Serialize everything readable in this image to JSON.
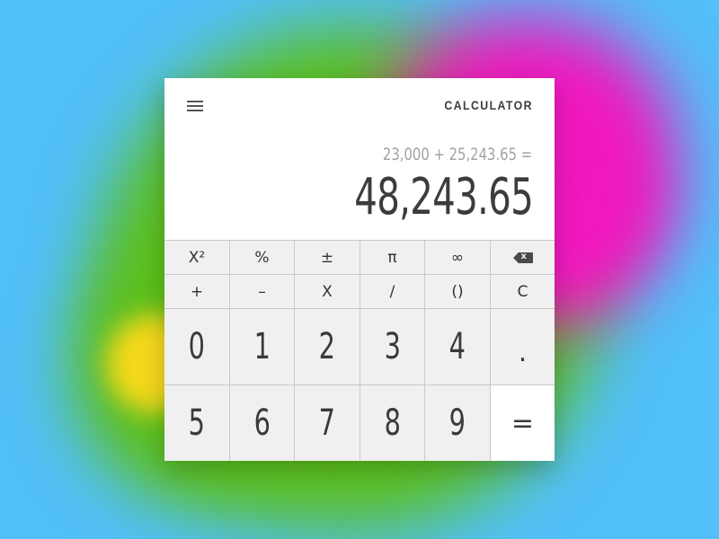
{
  "app": {
    "title": "CALCULATOR"
  },
  "display": {
    "expression": "23,000 + 25,243.65 =",
    "result": "48,243.65"
  },
  "keys": {
    "row1": [
      "X²",
      "%",
      "±",
      "π",
      "∞",
      ""
    ],
    "row2": [
      "+",
      "–",
      "X",
      "/",
      "()",
      "C"
    ],
    "row3": [
      "0",
      "1",
      "2",
      "3",
      "4",
      "."
    ],
    "row4": [
      "5",
      "6",
      "7",
      "8",
      "9",
      "="
    ]
  },
  "colors": {
    "background": "#52c0fa",
    "blob_green": "#5cbf1a",
    "blob_pink": "#f018bf",
    "blob_yellow": "#f5d81c",
    "card": "#ffffff",
    "keypad": "#f0f0f0",
    "result_text": "#3c3c3c",
    "expression_text": "#a3a3a3"
  },
  "icons": {
    "menu": "hamburger-menu-icon",
    "backspace": "backspace-icon"
  }
}
